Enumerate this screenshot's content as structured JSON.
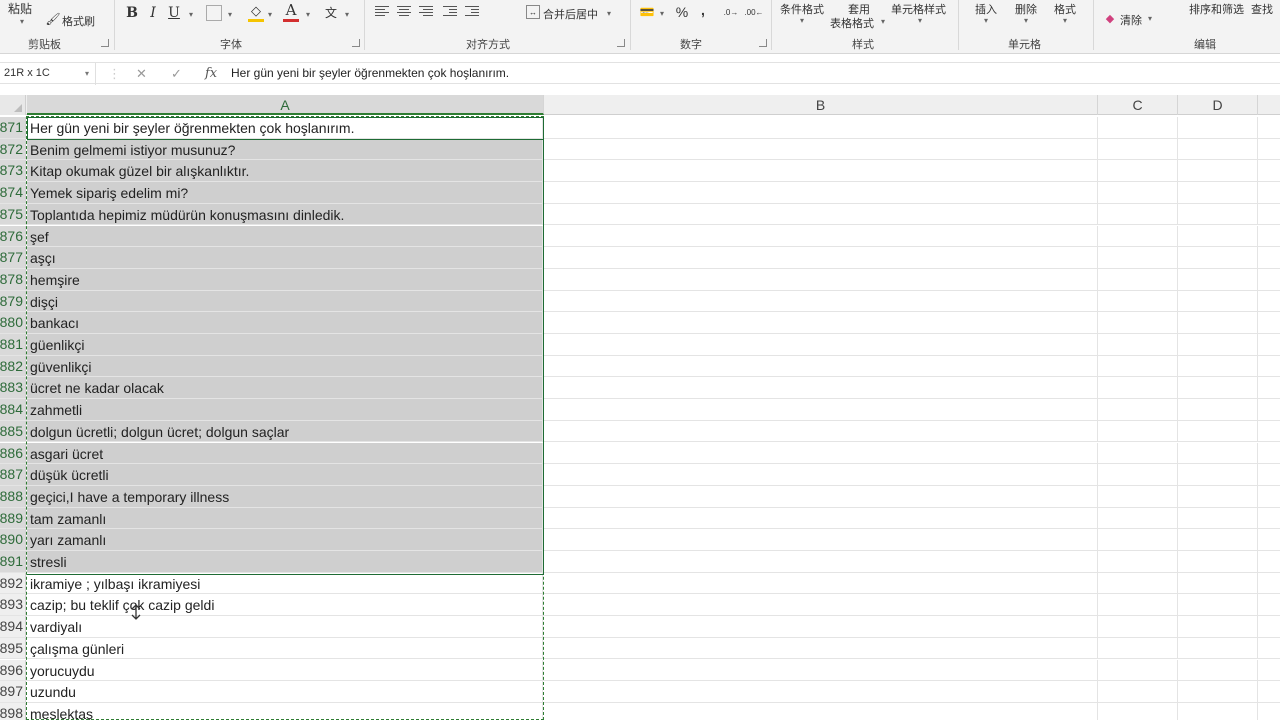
{
  "ribbon": {
    "clipboard": {
      "paste": "粘贴",
      "format_painter": "格式刷",
      "group": "剪贴板"
    },
    "font": {
      "bold": "B",
      "italic": "I",
      "underline": "U",
      "group": "字体",
      "fill_color": "#f5c400",
      "font_color": "#d32f2f"
    },
    "alignment": {
      "merge_center": "合并后居中",
      "group": "对齐方式"
    },
    "number": {
      "percent": "%",
      "comma": ",",
      "group": "数字"
    },
    "styles": {
      "conditional": "条件格式",
      "table_line1": "套用",
      "table_line2": "表格格式",
      "cell_styles": "单元格样式",
      "group": "样式"
    },
    "cells": {
      "insert": "插入",
      "delete": "删除",
      "format": "格式",
      "group": "单元格"
    },
    "editing": {
      "clear": "清除",
      "sort_filter": "排序和筛选",
      "find": "查找",
      "group": "编辑"
    }
  },
  "formula_bar": {
    "name_box": "21R x 1C",
    "cancel": "✕",
    "enter": "✓",
    "fx": "fx",
    "content": "Her gün yeni bir şeyler öğrenmekten çok hoşlanırım."
  },
  "columns": [
    "A",
    "B",
    "C",
    "D"
  ],
  "rows": [
    {
      "num": "871",
      "a": "Her gün yeni bir şeyler öğrenmekten çok hoşlanırım."
    },
    {
      "num": "872",
      "a": "Benim gelmemi istiyor musunuz?"
    },
    {
      "num": "873",
      "a": "Kitap okumak güzel bir alışkanlıktır."
    },
    {
      "num": "874",
      "a": "Yemek sipariş edelim mi?"
    },
    {
      "num": "875",
      "a": "Toplantıda hepimiz müdürün konuşmasını dinledik."
    },
    {
      "num": "876",
      "a": "şef"
    },
    {
      "num": "877",
      "a": "aşçı"
    },
    {
      "num": "878",
      "a": "hemşire"
    },
    {
      "num": "879",
      "a": "dişçi"
    },
    {
      "num": "880",
      "a": "bankacı"
    },
    {
      "num": "881",
      "a": "güenlikçi"
    },
    {
      "num": "882",
      "a": "güvenlikçi"
    },
    {
      "num": "883",
      "a": "ücret ne kadar olacak"
    },
    {
      "num": "884",
      "a": "zahmetli"
    },
    {
      "num": "885",
      "a": "dolgun ücretli; dolgun ücret; dolgun saçlar"
    },
    {
      "num": "886",
      "a": "asgari ücret"
    },
    {
      "num": "887",
      "a": "düşük ücretli"
    },
    {
      "num": "888",
      "a": "geçici,I have a temporary illness"
    },
    {
      "num": "889",
      "a": "tam zamanlı"
    },
    {
      "num": "890",
      "a": "yarı zamanlı"
    },
    {
      "num": "891",
      "a": "stresli"
    },
    {
      "num": "892",
      "a": "ikramiye ; yılbaşı ikramiyesi"
    },
    {
      "num": "893",
      "a": "cazip; bu teklif çok cazip geldi"
    },
    {
      "num": "894",
      "a": "vardiyalı"
    },
    {
      "num": "895",
      "a": "çalışma günleri"
    },
    {
      "num": "896",
      "a": "yorucuydu"
    },
    {
      "num": "897",
      "a": "uzundu"
    },
    {
      "num": "898",
      "a": "meslektaş"
    }
  ],
  "selection": {
    "first_row": "871",
    "last_row": "891",
    "highlight_color": "#cfcfcf",
    "accent_color": "#1e6b34"
  }
}
